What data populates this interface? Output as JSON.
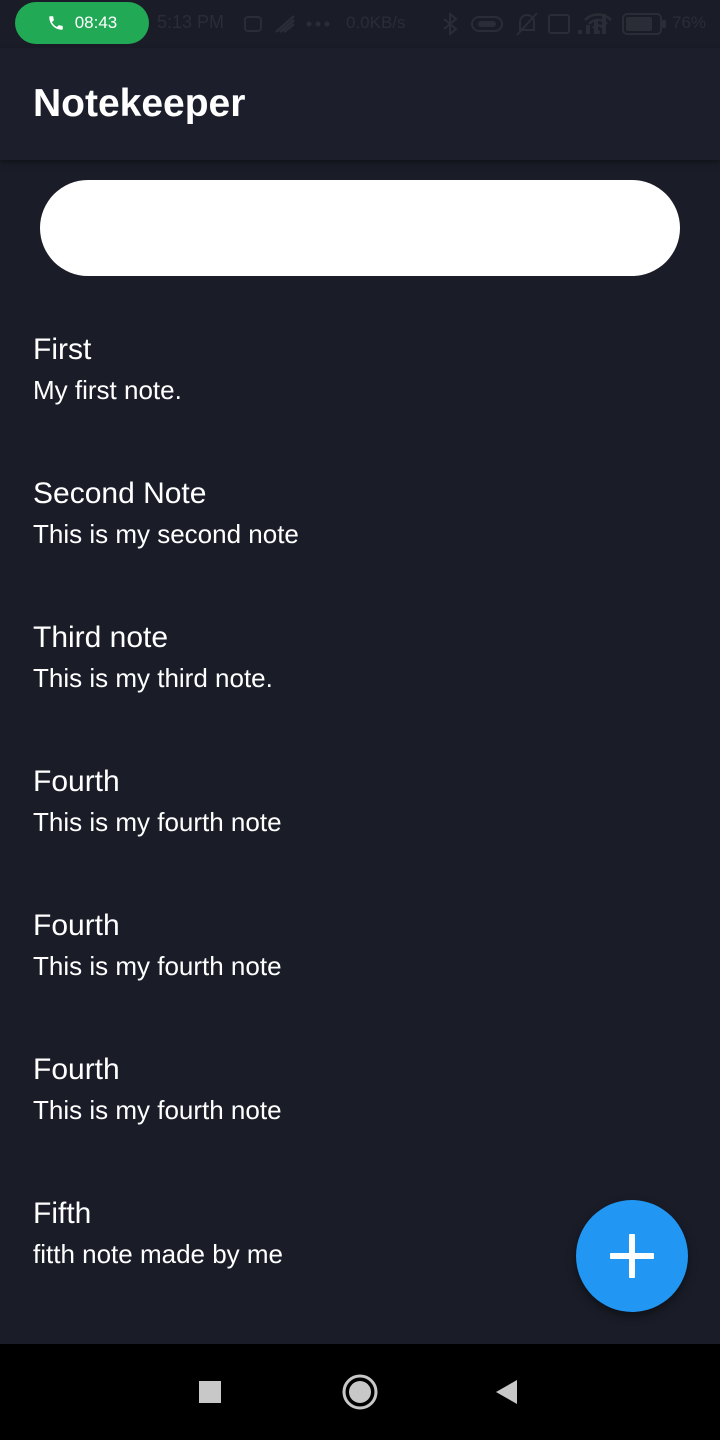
{
  "status_bar": {
    "call_time": "08:43",
    "clock": "5:13 PM",
    "network_speed": "0.0KB/s",
    "battery_percent": "76"
  },
  "app_bar": {
    "title": "Notekeeper"
  },
  "search": {
    "value": "",
    "placeholder": ""
  },
  "notes": [
    {
      "title": "First",
      "body": "My first note."
    },
    {
      "title": "Second Note",
      "body": "This is my second note"
    },
    {
      "title": "Third note",
      "body": "This is my third note."
    },
    {
      "title": "Fourth",
      "body": "This is my fourth note"
    },
    {
      "title": "Fourth",
      "body": "This is my fourth note"
    },
    {
      "title": "Fourth",
      "body": "This is my fourth note"
    },
    {
      "title": "Fifth",
      "body": "fitth note made by me"
    }
  ],
  "fab": {
    "icon": "plus-icon",
    "color": "#2196f3"
  },
  "nav_bar": {
    "icons": [
      "recents-icon",
      "home-icon",
      "back-icon"
    ]
  },
  "colors": {
    "background": "#1a1d28",
    "app_bar": "#1c1f2b",
    "call_pill": "#22a956",
    "text": "#ffffff"
  }
}
